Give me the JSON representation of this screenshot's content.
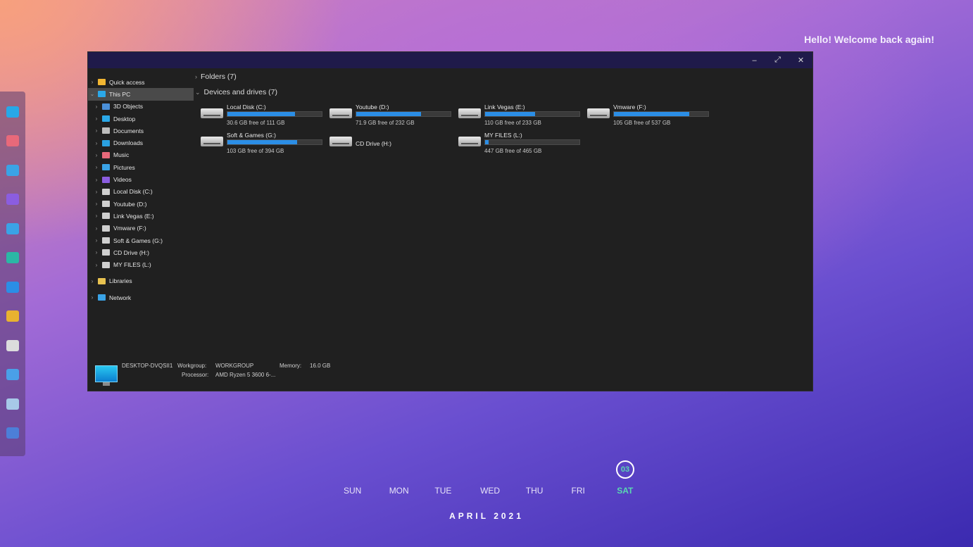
{
  "desktop": {
    "welcome": "Hello! Welcome back again!"
  },
  "dock": [
    {
      "name": "this-pc-icon",
      "color": "#27a8e8"
    },
    {
      "name": "music-icon",
      "color": "#e8697a"
    },
    {
      "name": "pictures-icon",
      "color": "#3aa3e6"
    },
    {
      "name": "videos-icon",
      "color": "#8b5de0"
    },
    {
      "name": "gallery-icon",
      "color": "#3aa3e6"
    },
    {
      "name": "downloads-icon",
      "color": "#2bb7a5"
    },
    {
      "name": "folder-icon",
      "color": "#2b8ee6"
    },
    {
      "name": "folder-share-icon",
      "color": "#e8b230"
    },
    {
      "name": "camera-icon",
      "color": "#dcdcdc"
    },
    {
      "name": "storage-icon",
      "color": "#4aa0e8"
    },
    {
      "name": "recycle-bin-icon",
      "color": "#a7c9e8"
    },
    {
      "name": "settings-icon",
      "color": "#4c7fd8"
    }
  ],
  "window": {
    "buttons": {
      "minimize": "–",
      "maximize": "⤢",
      "close": "✕"
    },
    "nav": [
      {
        "label": "Quick access",
        "icon": "star-icon",
        "color": "#f2b632",
        "level": 0
      },
      {
        "label": "This PC",
        "icon": "this-pc-icon",
        "color": "#2ba8e8",
        "level": 0,
        "selected": true,
        "expanded": true
      },
      {
        "label": "3D Objects",
        "icon": "cube-icon",
        "color": "#4a8fd8",
        "level": 1
      },
      {
        "label": "Desktop",
        "icon": "desktop-icon",
        "color": "#2ba8e8",
        "level": 1
      },
      {
        "label": "Documents",
        "icon": "document-icon",
        "color": "#bdbdbd",
        "level": 1
      },
      {
        "label": "Downloads",
        "icon": "download-icon",
        "color": "#2aa0e0",
        "level": 1
      },
      {
        "label": "Music",
        "icon": "music-icon",
        "color": "#e8697a",
        "level": 1
      },
      {
        "label": "Pictures",
        "icon": "picture-icon",
        "color": "#3aa3e6",
        "level": 1
      },
      {
        "label": "Videos",
        "icon": "video-icon",
        "color": "#8b5de0",
        "level": 1
      },
      {
        "label": "Local Disk (C:)",
        "icon": "drive-icon",
        "color": "#cfcfcf",
        "level": 1
      },
      {
        "label": "Youtube (D:)",
        "icon": "drive-icon",
        "color": "#cfcfcf",
        "level": 1
      },
      {
        "label": "Link Vegas (E:)",
        "icon": "drive-icon",
        "color": "#cfcfcf",
        "level": 1
      },
      {
        "label": "Vmware  (F:)",
        "icon": "drive-icon",
        "color": "#cfcfcf",
        "level": 1
      },
      {
        "label": "Soft & Games (G:)",
        "icon": "drive-icon",
        "color": "#cfcfcf",
        "level": 1
      },
      {
        "label": "CD Drive (H:)",
        "icon": "cd-drive-icon",
        "color": "#cfcfcf",
        "level": 1
      },
      {
        "label": "MY FILES (L:)",
        "icon": "drive-icon",
        "color": "#cfcfcf",
        "level": 1
      },
      {
        "label": "Libraries",
        "icon": "folder-icon",
        "color": "#e8c250",
        "level": 0,
        "gap": true
      },
      {
        "label": "Network",
        "icon": "network-icon",
        "color": "#3aa3e6",
        "level": 0,
        "gap": true
      }
    ],
    "folders_header": "Folders (7)",
    "devices_header": "Devices and drives (7)",
    "drives": [
      {
        "name": "Local Disk (C:)",
        "free": "30.6 GB free of 111 GB",
        "used": 0.72,
        "windows": true
      },
      {
        "name": "Youtube (D:)",
        "free": "71.9 GB free of 232 GB",
        "used": 0.69
      },
      {
        "name": "Link Vegas (E:)",
        "free": "110 GB free of 233 GB",
        "used": 0.53
      },
      {
        "name": "Vmware  (F:)",
        "free": "105 GB free of 537 GB",
        "used": 0.8
      },
      {
        "name": "Soft & Games (G:)",
        "free": "103 GB free of 394 GB",
        "used": 0.74
      },
      {
        "name": "CD Drive (H:)",
        "free": "",
        "used": null,
        "cd": true
      },
      {
        "name": "MY FILES (L:)",
        "free": "447 GB free of 465 GB",
        "used": 0.04
      }
    ],
    "details": {
      "computer": "DESKTOP-DVQSII1",
      "workgroup_label": "Workgroup:",
      "workgroup": "WORKGROUP",
      "memory_label": "Memory:",
      "memory": "16.0 GB",
      "processor_label": "Processor:",
      "processor": "AMD Ryzen 5 3600 6-..."
    }
  },
  "calendar": {
    "days": [
      "SUN",
      "MON",
      "TUE",
      "WED",
      "THU",
      "FRI",
      "SAT"
    ],
    "today_index": 6,
    "date": "03",
    "month": "APRIL 2021",
    "accent": "#5ad7b2"
  }
}
